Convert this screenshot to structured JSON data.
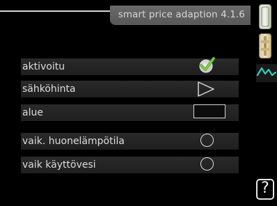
{
  "header": {
    "title": "smart price adaption 4.1.6"
  },
  "menu": {
    "rows": [
      {
        "label": "aktivoitu",
        "control": "checkbox",
        "checked": true,
        "control_icon": "checkmark-icon"
      },
      {
        "label": "sähköhinta",
        "control": "navigate",
        "control_icon": "triangle-right-icon"
      },
      {
        "label": "alue",
        "control": "value-box",
        "value": ""
      },
      {
        "label": "vaik. huonelämpötila",
        "control": "radio",
        "checked": false,
        "control_icon": "radio-circle-icon"
      },
      {
        "label": "vaik käyttövesi",
        "control": "radio",
        "checked": false,
        "control_icon": "radio-circle-icon"
      }
    ]
  },
  "side_tabs": {
    "icons": [
      "thermometer-tab-icon",
      "ruler-tab-icon",
      "price-graph-tab-icon"
    ],
    "accent": "#2fd0b8"
  },
  "help": {
    "glyph": "?"
  },
  "colors": {
    "check_green": "#7ac143",
    "row_bg": "#262626",
    "text": "#dcdcdc"
  }
}
